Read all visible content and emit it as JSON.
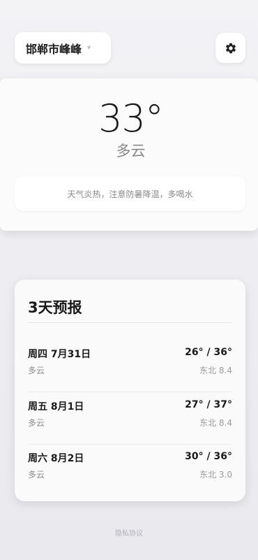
{
  "header": {
    "location": "邯郸市峰峰",
    "chevron": "▾",
    "settings_icon": "gear-icon"
  },
  "current": {
    "temperature": "33°",
    "condition": "多云",
    "tip": "天气炎热，注意防暑降温，多喝水"
  },
  "forecast": {
    "title": "3天预报",
    "days": [
      {
        "date": "周四 7月31日",
        "condition": "多云",
        "range": "26° / 36°",
        "wind": "东北 8.4"
      },
      {
        "date": "周五 8月1日",
        "condition": "多云",
        "range": "27° / 37°",
        "wind": "东北 8.4"
      },
      {
        "date": "周六 8月2日",
        "condition": "多云",
        "range": "30° / 36°",
        "wind": "东北 3.0"
      }
    ]
  },
  "footer": {
    "privacy": "隐私协议"
  }
}
